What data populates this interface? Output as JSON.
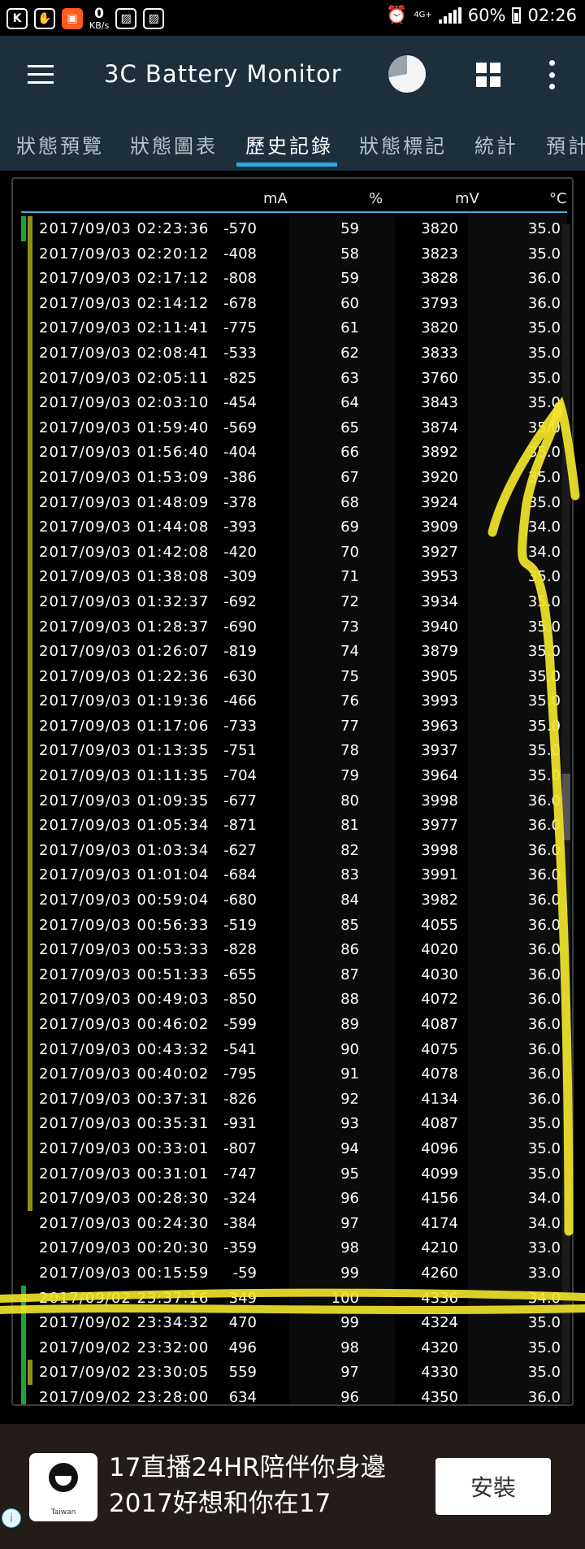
{
  "status_bar": {
    "kbps_value": "0",
    "kbps_unit": "KB/s",
    "network": "4G+",
    "battery_percent": "60%",
    "time": "02:26"
  },
  "app": {
    "title": "3C Battery Monitor"
  },
  "tabs": [
    {
      "label": "狀態預覽",
      "active": false
    },
    {
      "label": "狀態圖表",
      "active": false
    },
    {
      "label": "歷史記錄",
      "active": true
    },
    {
      "label": "狀態標記",
      "active": false
    },
    {
      "label": "統計",
      "active": false
    },
    {
      "label": "預計",
      "active": false
    }
  ],
  "table": {
    "headers": {
      "ma": "mA",
      "percent": "%",
      "mv": "mV",
      "temp": "°C"
    },
    "rows": [
      {
        "dt": "2017/09/03 02:23:36",
        "ma": "-570",
        "pct": "59",
        "mv": "3820",
        "temp": "35.0",
        "marker": "green+olive"
      },
      {
        "dt": "2017/09/03 02:20:12",
        "ma": "-408",
        "pct": "58",
        "mv": "3823",
        "temp": "35.0",
        "marker": "olive"
      },
      {
        "dt": "2017/09/03 02:17:12",
        "ma": "-808",
        "pct": "59",
        "mv": "3828",
        "temp": "36.0",
        "marker": "olive"
      },
      {
        "dt": "2017/09/03 02:14:12",
        "ma": "-678",
        "pct": "60",
        "mv": "3793",
        "temp": "36.0",
        "marker": "olive"
      },
      {
        "dt": "2017/09/03 02:11:41",
        "ma": "-775",
        "pct": "61",
        "mv": "3820",
        "temp": "35.0",
        "marker": "olive"
      },
      {
        "dt": "2017/09/03 02:08:41",
        "ma": "-533",
        "pct": "62",
        "mv": "3833",
        "temp": "35.0",
        "marker": "olive"
      },
      {
        "dt": "2017/09/03 02:05:11",
        "ma": "-825",
        "pct": "63",
        "mv": "3760",
        "temp": "35.0",
        "marker": "olive"
      },
      {
        "dt": "2017/09/03 02:03:10",
        "ma": "-454",
        "pct": "64",
        "mv": "3843",
        "temp": "35.0",
        "marker": "olive"
      },
      {
        "dt": "2017/09/03 01:59:40",
        "ma": "-569",
        "pct": "65",
        "mv": "3874",
        "temp": "35.0",
        "marker": "olive"
      },
      {
        "dt": "2017/09/03 01:56:40",
        "ma": "-404",
        "pct": "66",
        "mv": "3892",
        "temp": "35.0",
        "marker": "olive"
      },
      {
        "dt": "2017/09/03 01:53:09",
        "ma": "-386",
        "pct": "67",
        "mv": "3920",
        "temp": "35.0",
        "marker": "olive"
      },
      {
        "dt": "2017/09/03 01:48:09",
        "ma": "-378",
        "pct": "68",
        "mv": "3924",
        "temp": "35.0",
        "marker": "olive"
      },
      {
        "dt": "2017/09/03 01:44:08",
        "ma": "-393",
        "pct": "69",
        "mv": "3909",
        "temp": "34.0",
        "marker": "olive"
      },
      {
        "dt": "2017/09/03 01:42:08",
        "ma": "-420",
        "pct": "70",
        "mv": "3927",
        "temp": "34.0",
        "marker": "olive"
      },
      {
        "dt": "2017/09/03 01:38:08",
        "ma": "-309",
        "pct": "71",
        "mv": "3953",
        "temp": "35.0",
        "marker": "olive"
      },
      {
        "dt": "2017/09/03 01:32:37",
        "ma": "-692",
        "pct": "72",
        "mv": "3934",
        "temp": "35.0",
        "marker": "olive"
      },
      {
        "dt": "2017/09/03 01:28:37",
        "ma": "-690",
        "pct": "73",
        "mv": "3940",
        "temp": "35.0",
        "marker": "olive"
      },
      {
        "dt": "2017/09/03 01:26:07",
        "ma": "-819",
        "pct": "74",
        "mv": "3879",
        "temp": "35.0",
        "marker": "olive"
      },
      {
        "dt": "2017/09/03 01:22:36",
        "ma": "-630",
        "pct": "75",
        "mv": "3905",
        "temp": "35.0",
        "marker": "olive"
      },
      {
        "dt": "2017/09/03 01:19:36",
        "ma": "-466",
        "pct": "76",
        "mv": "3993",
        "temp": "35.0",
        "marker": "olive"
      },
      {
        "dt": "2017/09/03 01:17:06",
        "ma": "-733",
        "pct": "77",
        "mv": "3963",
        "temp": "35.0",
        "marker": "olive"
      },
      {
        "dt": "2017/09/03 01:13:35",
        "ma": "-751",
        "pct": "78",
        "mv": "3937",
        "temp": "35.0",
        "marker": "olive"
      },
      {
        "dt": "2017/09/03 01:11:35",
        "ma": "-704",
        "pct": "79",
        "mv": "3964",
        "temp": "35.0",
        "marker": "olive"
      },
      {
        "dt": "2017/09/03 01:09:35",
        "ma": "-677",
        "pct": "80",
        "mv": "3998",
        "temp": "36.0",
        "marker": "olive"
      },
      {
        "dt": "2017/09/03 01:05:34",
        "ma": "-871",
        "pct": "81",
        "mv": "3977",
        "temp": "36.0",
        "marker": "olive"
      },
      {
        "dt": "2017/09/03 01:03:34",
        "ma": "-627",
        "pct": "82",
        "mv": "3998",
        "temp": "36.0",
        "marker": "olive"
      },
      {
        "dt": "2017/09/03 01:01:04",
        "ma": "-684",
        "pct": "83",
        "mv": "3991",
        "temp": "36.0",
        "marker": "olive"
      },
      {
        "dt": "2017/09/03 00:59:04",
        "ma": "-680",
        "pct": "84",
        "mv": "3982",
        "temp": "36.0",
        "marker": "olive"
      },
      {
        "dt": "2017/09/03 00:56:33",
        "ma": "-519",
        "pct": "85",
        "mv": "4055",
        "temp": "36.0",
        "marker": "olive"
      },
      {
        "dt": "2017/09/03 00:53:33",
        "ma": "-828",
        "pct": "86",
        "mv": "4020",
        "temp": "36.0",
        "marker": "olive"
      },
      {
        "dt": "2017/09/03 00:51:33",
        "ma": "-655",
        "pct": "87",
        "mv": "4030",
        "temp": "36.0",
        "marker": "olive"
      },
      {
        "dt": "2017/09/03 00:49:03",
        "ma": "-850",
        "pct": "88",
        "mv": "4072",
        "temp": "36.0",
        "marker": "olive"
      },
      {
        "dt": "2017/09/03 00:46:02",
        "ma": "-599",
        "pct": "89",
        "mv": "4087",
        "temp": "36.0",
        "marker": "olive"
      },
      {
        "dt": "2017/09/03 00:43:32",
        "ma": "-541",
        "pct": "90",
        "mv": "4075",
        "temp": "36.0",
        "marker": "olive"
      },
      {
        "dt": "2017/09/03 00:40:02",
        "ma": "-795",
        "pct": "91",
        "mv": "4078",
        "temp": "36.0",
        "marker": "olive"
      },
      {
        "dt": "2017/09/03 00:37:31",
        "ma": "-826",
        "pct": "92",
        "mv": "4134",
        "temp": "36.0",
        "marker": "olive"
      },
      {
        "dt": "2017/09/03 00:35:31",
        "ma": "-931",
        "pct": "93",
        "mv": "4087",
        "temp": "35.0",
        "marker": "olive"
      },
      {
        "dt": "2017/09/03 00:33:01",
        "ma": "-807",
        "pct": "94",
        "mv": "4096",
        "temp": "35.0",
        "marker": "olive"
      },
      {
        "dt": "2017/09/03 00:31:01",
        "ma": "-747",
        "pct": "95",
        "mv": "4099",
        "temp": "35.0",
        "marker": "olive"
      },
      {
        "dt": "2017/09/03 00:28:30",
        "ma": "-324",
        "pct": "96",
        "mv": "4156",
        "temp": "34.0",
        "marker": "olive"
      },
      {
        "dt": "2017/09/03 00:24:30",
        "ma": "-384",
        "pct": "97",
        "mv": "4174",
        "temp": "34.0",
        "marker": "none"
      },
      {
        "dt": "2017/09/03 00:20:30",
        "ma": "-359",
        "pct": "98",
        "mv": "4210",
        "temp": "33.0",
        "marker": "none"
      },
      {
        "dt": "2017/09/03 00:15:59",
        "ma": "-59",
        "pct": "99",
        "mv": "4260",
        "temp": "33.0",
        "marker": "none"
      },
      {
        "dt": "2017/09/02 23:37:16",
        "ma": "349",
        "pct": "100",
        "mv": "4336",
        "temp": "34.0",
        "marker": "green"
      },
      {
        "dt": "2017/09/02 23:34:32",
        "ma": "470",
        "pct": "99",
        "mv": "4324",
        "temp": "35.0",
        "marker": "green"
      },
      {
        "dt": "2017/09/02 23:32:00",
        "ma": "496",
        "pct": "98",
        "mv": "4320",
        "temp": "35.0",
        "marker": "green"
      },
      {
        "dt": "2017/09/02 23:30:05",
        "ma": "559",
        "pct": "97",
        "mv": "4330",
        "temp": "35.0",
        "marker": "green+olive"
      },
      {
        "dt": "2017/09/02 23:28:00",
        "ma": "634",
        "pct": "96",
        "mv": "4350",
        "temp": "36.0",
        "marker": "green"
      }
    ]
  },
  "ad": {
    "line1": "17直播24HR陪伴你身邊",
    "line2": "2017好想和你在17",
    "logo_text": "Taiwan",
    "install_label": "安裝",
    "info_glyph": "i"
  },
  "colors": {
    "appbar": "#1c2f3b",
    "tab_indicator": "#29a8e0",
    "marker_green": "#1fa23a",
    "marker_olive": "#8f8f17",
    "annotation_yellow": "#f2e52a"
  }
}
